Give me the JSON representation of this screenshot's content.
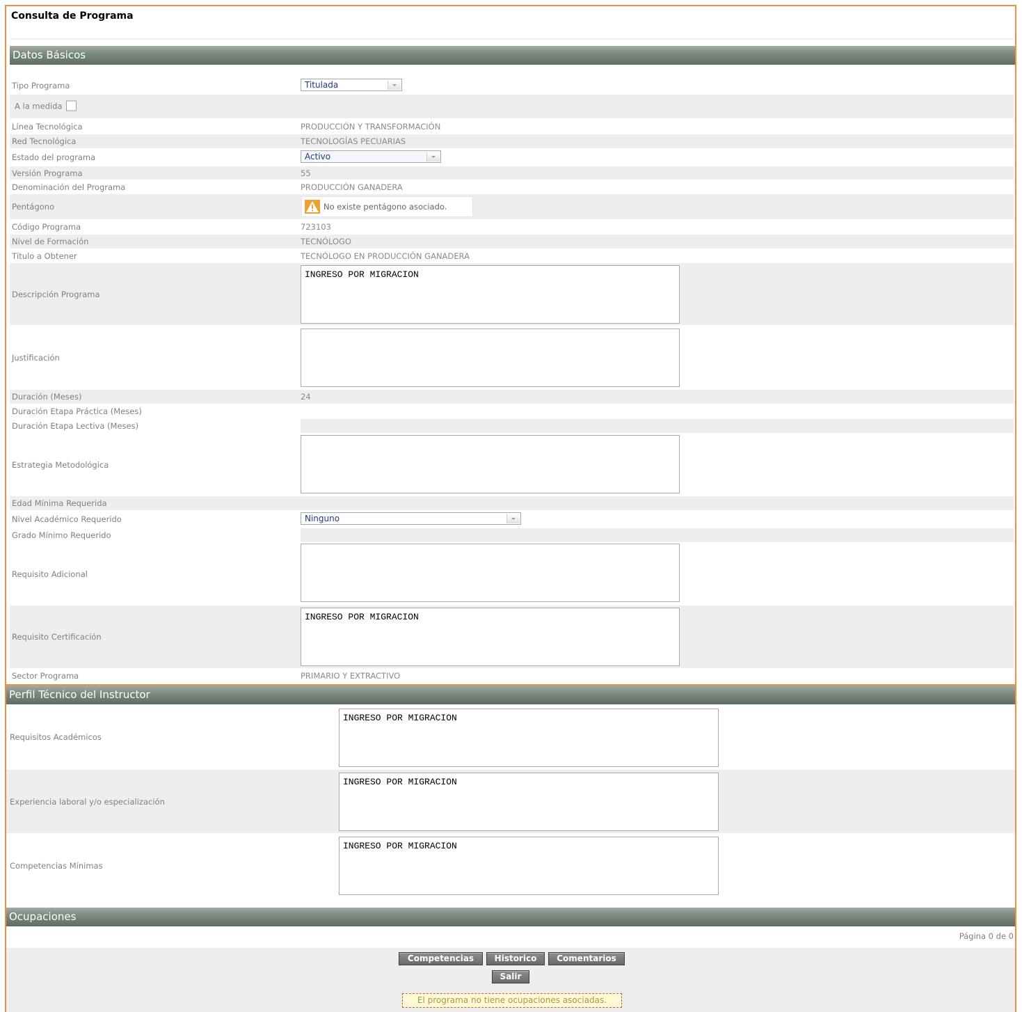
{
  "page": {
    "title": "Consulta de Programa"
  },
  "datos_basicos": {
    "header": "Datos Básicos",
    "tipo_programa": {
      "label": "Tipo Programa",
      "value": "Titulada"
    },
    "a_la_medida": {
      "label": "A la medida",
      "checked": false
    },
    "linea_tecnologica": {
      "label": "Línea Tecnológica",
      "value": "PRODUCCIÓN Y TRANSFORMACIÓN"
    },
    "red_tecnologica": {
      "label": "Red Tecnológica",
      "value": "TECNOLOGÍAS PECUARIAS"
    },
    "estado_programa": {
      "label": "Estado del programa",
      "value": "Activo"
    },
    "version_programa": {
      "label": "Versión Programa",
      "value": "55"
    },
    "denominacion": {
      "label": "Denominación del Programa",
      "value": "PRODUCCIÓN GANADERA"
    },
    "pentagono": {
      "label": "Pentágono",
      "value": "No existe pentágono asociado.",
      "icon": "warning-icon"
    },
    "codigo": {
      "label": "Código Programa",
      "value": "723103"
    },
    "nivel_formacion": {
      "label": "Nivel de Formación",
      "value": "TECNÓLOGO"
    },
    "titulo": {
      "label": "Título a Obtener",
      "value": "TECNÓLOGO EN PRODUCCIÓN GANADERA"
    },
    "descripcion": {
      "label": "Descripción Programa",
      "value": "INGRESO POR MIGRACION"
    },
    "justificacion": {
      "label": "Justificación",
      "value": ""
    },
    "duracion": {
      "label": "Duración (Meses)",
      "value": "24"
    },
    "duracion_practica": {
      "label": "Duración Etapa Práctica (Meses)",
      "value": ""
    },
    "duracion_lectiva": {
      "label": "Duración Etapa Lectiva (Meses)",
      "value": ""
    },
    "estrategia": {
      "label": "Estrategia Metodológica",
      "value": ""
    },
    "edad_minima": {
      "label": "Edad Mínima Requerida",
      "value": ""
    },
    "nivel_academico": {
      "label": "Nivel Académico Requerido",
      "value": "Ninguno"
    },
    "grado_minimo": {
      "label": "Grado Mínimo Requerido",
      "value": ""
    },
    "requisito_adicional": {
      "label": "Requisito Adicional",
      "value": ""
    },
    "requisito_certificacion": {
      "label": "Requisito Certificación",
      "value": "INGRESO POR MIGRACION"
    },
    "sector": {
      "label": "Sector Programa",
      "value": "PRIMARIO Y EXTRACTIVO"
    }
  },
  "perfil_instructor": {
    "header": "Perfil Técnico del Instructor",
    "requisitos_academicos": {
      "label": "Requisitos Académicos",
      "value": "INGRESO POR MIGRACION"
    },
    "experiencia": {
      "label": "Experiencia laboral y/o especialización",
      "value": "INGRESO POR MIGRACION"
    },
    "competencias_minimas": {
      "label": "Competencias Mínimas",
      "value": "INGRESO POR MIGRACION"
    }
  },
  "ocupaciones": {
    "header": "Ocupaciones",
    "pager": "Página 0 de 0",
    "notice": "El programa no tiene ocupaciones asociadas."
  },
  "buttons": {
    "competencias": "Competencias",
    "historico": "Historico",
    "comentarios": "Comentarios",
    "salir": "Salir"
  },
  "colors": {
    "accent_border": "#f0903c",
    "header_bg": "#6f7e74",
    "alt_row": "#eeeeee",
    "notice_border": "#e05a2a"
  }
}
